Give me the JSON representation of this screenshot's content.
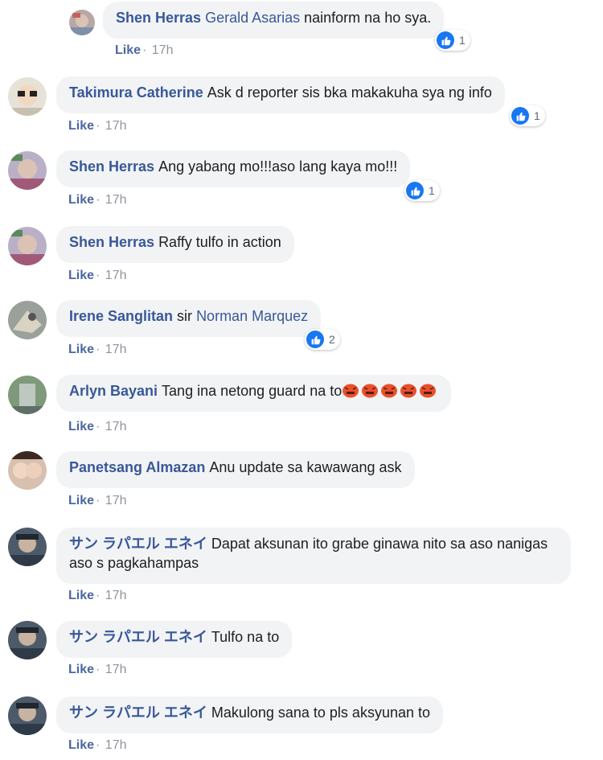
{
  "comments": [
    {
      "author": "Shen Herras",
      "mention": "Gerald Asarias",
      "text": "nainform na ho sya.",
      "like_label": "Like",
      "time": "17h",
      "reactions": "1"
    },
    {
      "author": "Takimura Catherine",
      "text": "Ask d reporter sis bka makakuha sya ng info",
      "like_label": "Like",
      "time": "17h",
      "reactions": "1"
    },
    {
      "author": "Shen Herras",
      "text": "Ang yabang mo!!!aso lang kaya mo!!!",
      "like_label": "Like",
      "time": "17h",
      "reactions": "1"
    },
    {
      "author": "Shen Herras",
      "text": "Raffy tulfo in action",
      "like_label": "Like",
      "time": "17h"
    },
    {
      "author": "Irene Sanglitan",
      "text": "sir",
      "mention": "Norman Marquez",
      "like_label": "Like",
      "time": "17h",
      "reactions": "2"
    },
    {
      "author": "Arlyn Bayani",
      "text": "Tang ina netong guard na to",
      "emoji_icon": "rage-face-icon",
      "like_label": "Like",
      "time": "17h"
    },
    {
      "author": "Panetsang Almazan",
      "text": "Anu update sa kawawang ask",
      "like_label": "Like",
      "time": "17h"
    },
    {
      "author": "サン ラパエル エネイ",
      "text": "Dapat aksunan ito grabe ginawa nito sa aso nanigas aso s pagkahampas",
      "like_label": "Like",
      "time": "17h"
    },
    {
      "author": "サン ラパエル エネイ",
      "text": "Tulfo na to",
      "like_label": "Like",
      "time": "17h"
    },
    {
      "author": "サン ラパエル エネイ",
      "text": "Makulong sana to pls aksyunan to",
      "like_label": "Like",
      "time": "17h"
    }
  ],
  "separator": "·",
  "colors": {
    "link": "#385898",
    "bubble": "#f2f3f5",
    "meta": "#90949c",
    "like_blue": "#1877f2"
  }
}
